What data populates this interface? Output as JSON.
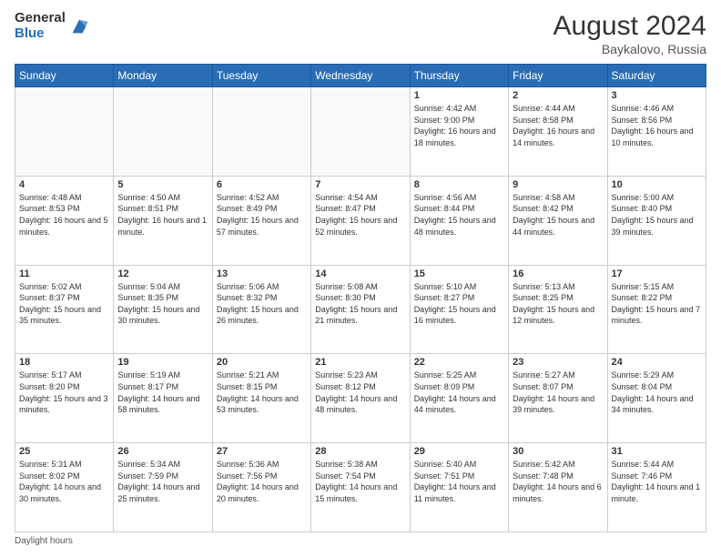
{
  "header": {
    "logo_general": "General",
    "logo_blue": "Blue",
    "month_year": "August 2024",
    "location": "Baykalovo, Russia"
  },
  "weekdays": [
    "Sunday",
    "Monday",
    "Tuesday",
    "Wednesday",
    "Thursday",
    "Friday",
    "Saturday"
  ],
  "footer": {
    "note": "Daylight hours"
  },
  "weeks": [
    [
      {
        "day": "",
        "info": ""
      },
      {
        "day": "",
        "info": ""
      },
      {
        "day": "",
        "info": ""
      },
      {
        "day": "",
        "info": ""
      },
      {
        "day": "1",
        "info": "Sunrise: 4:42 AM\nSunset: 9:00 PM\nDaylight: 16 hours\nand 18 minutes."
      },
      {
        "day": "2",
        "info": "Sunrise: 4:44 AM\nSunset: 8:58 PM\nDaylight: 16 hours\nand 14 minutes."
      },
      {
        "day": "3",
        "info": "Sunrise: 4:46 AM\nSunset: 8:56 PM\nDaylight: 16 hours\nand 10 minutes."
      }
    ],
    [
      {
        "day": "4",
        "info": "Sunrise: 4:48 AM\nSunset: 8:53 PM\nDaylight: 16 hours\nand 5 minutes."
      },
      {
        "day": "5",
        "info": "Sunrise: 4:50 AM\nSunset: 8:51 PM\nDaylight: 16 hours\nand 1 minute."
      },
      {
        "day": "6",
        "info": "Sunrise: 4:52 AM\nSunset: 8:49 PM\nDaylight: 15 hours\nand 57 minutes."
      },
      {
        "day": "7",
        "info": "Sunrise: 4:54 AM\nSunset: 8:47 PM\nDaylight: 15 hours\nand 52 minutes."
      },
      {
        "day": "8",
        "info": "Sunrise: 4:56 AM\nSunset: 8:44 PM\nDaylight: 15 hours\nand 48 minutes."
      },
      {
        "day": "9",
        "info": "Sunrise: 4:58 AM\nSunset: 8:42 PM\nDaylight: 15 hours\nand 44 minutes."
      },
      {
        "day": "10",
        "info": "Sunrise: 5:00 AM\nSunset: 8:40 PM\nDaylight: 15 hours\nand 39 minutes."
      }
    ],
    [
      {
        "day": "11",
        "info": "Sunrise: 5:02 AM\nSunset: 8:37 PM\nDaylight: 15 hours\nand 35 minutes."
      },
      {
        "day": "12",
        "info": "Sunrise: 5:04 AM\nSunset: 8:35 PM\nDaylight: 15 hours\nand 30 minutes."
      },
      {
        "day": "13",
        "info": "Sunrise: 5:06 AM\nSunset: 8:32 PM\nDaylight: 15 hours\nand 26 minutes."
      },
      {
        "day": "14",
        "info": "Sunrise: 5:08 AM\nSunset: 8:30 PM\nDaylight: 15 hours\nand 21 minutes."
      },
      {
        "day": "15",
        "info": "Sunrise: 5:10 AM\nSunset: 8:27 PM\nDaylight: 15 hours\nand 16 minutes."
      },
      {
        "day": "16",
        "info": "Sunrise: 5:13 AM\nSunset: 8:25 PM\nDaylight: 15 hours\nand 12 minutes."
      },
      {
        "day": "17",
        "info": "Sunrise: 5:15 AM\nSunset: 8:22 PM\nDaylight: 15 hours\nand 7 minutes."
      }
    ],
    [
      {
        "day": "18",
        "info": "Sunrise: 5:17 AM\nSunset: 8:20 PM\nDaylight: 15 hours\nand 3 minutes."
      },
      {
        "day": "19",
        "info": "Sunrise: 5:19 AM\nSunset: 8:17 PM\nDaylight: 14 hours\nand 58 minutes."
      },
      {
        "day": "20",
        "info": "Sunrise: 5:21 AM\nSunset: 8:15 PM\nDaylight: 14 hours\nand 53 minutes."
      },
      {
        "day": "21",
        "info": "Sunrise: 5:23 AM\nSunset: 8:12 PM\nDaylight: 14 hours\nand 48 minutes."
      },
      {
        "day": "22",
        "info": "Sunrise: 5:25 AM\nSunset: 8:09 PM\nDaylight: 14 hours\nand 44 minutes."
      },
      {
        "day": "23",
        "info": "Sunrise: 5:27 AM\nSunset: 8:07 PM\nDaylight: 14 hours\nand 39 minutes."
      },
      {
        "day": "24",
        "info": "Sunrise: 5:29 AM\nSunset: 8:04 PM\nDaylight: 14 hours\nand 34 minutes."
      }
    ],
    [
      {
        "day": "25",
        "info": "Sunrise: 5:31 AM\nSunset: 8:02 PM\nDaylight: 14 hours\nand 30 minutes."
      },
      {
        "day": "26",
        "info": "Sunrise: 5:34 AM\nSunset: 7:59 PM\nDaylight: 14 hours\nand 25 minutes."
      },
      {
        "day": "27",
        "info": "Sunrise: 5:36 AM\nSunset: 7:56 PM\nDaylight: 14 hours\nand 20 minutes."
      },
      {
        "day": "28",
        "info": "Sunrise: 5:38 AM\nSunset: 7:54 PM\nDaylight: 14 hours\nand 15 minutes."
      },
      {
        "day": "29",
        "info": "Sunrise: 5:40 AM\nSunset: 7:51 PM\nDaylight: 14 hours\nand 11 minutes."
      },
      {
        "day": "30",
        "info": "Sunrise: 5:42 AM\nSunset: 7:48 PM\nDaylight: 14 hours\nand 6 minutes."
      },
      {
        "day": "31",
        "info": "Sunrise: 5:44 AM\nSunset: 7:46 PM\nDaylight: 14 hours\nand 1 minute."
      }
    ]
  ]
}
